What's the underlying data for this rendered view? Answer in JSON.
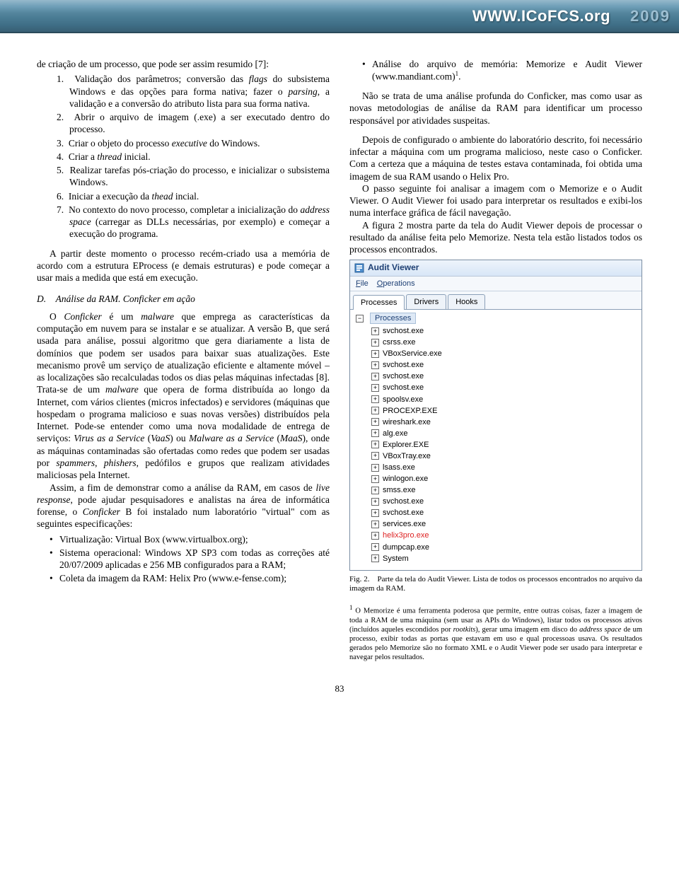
{
  "banner": {
    "url": "WWW.ICoFCS.org",
    "year": "2009"
  },
  "left": {
    "intro": "de criação de um processo, que pode ser assim resumido [7]:",
    "steps": [
      {
        "n": "1.",
        "t": "Validação dos parâmetros; conversão das <i>flags</i> do subsistema Windows e das opções para forma nativa; fazer o <i>parsing</i>, a validação e a conversão do atributo lista para sua forma nativa."
      },
      {
        "n": "2.",
        "t": "Abrir o arquivo de imagem (.exe) a ser executado dentro do processo."
      },
      {
        "n": "3.",
        "t": "Criar o objeto do processo <i>executive</i> do Windows."
      },
      {
        "n": "4.",
        "t": "Criar a <i>thread</i> inicial."
      },
      {
        "n": "5.",
        "t": "Realizar tarefas pós-criação do processo, e inicializar o subsistema Windows."
      },
      {
        "n": "6.",
        "t": "Iniciar a execução da <i>thead</i> incial."
      },
      {
        "n": "7.",
        "t": "No contexto do novo processo, completar a inicialização do <i>address space</i> (carregar as DLLs necessárias, por exemplo) e começar a execução do programa."
      }
    ],
    "p_after_steps": "A partir deste momento o processo recém-criado usa a memória de acordo com a estrutura EProcess (e demais estruturas) e pode começar a usar mais a medida que está em execução.",
    "section_d": "D. Análise da RAM. Conficker em ação",
    "p_d1": "O <i>Conficker</i> é um <i>malware</i> que emprega as características da computação em nuvem para se instalar e se atualizar. A versão B, que será usada para análise, possui algoritmo que gera diariamente a lista de domínios que podem ser usados para baixar suas atualizações. Este mecanismo provê um serviço de atualização eficiente e altamente móvel – as localizações são recalculadas todos os dias pelas máquinas infectadas [8]. Trata-se de um <i>malware</i> que opera de forma distribuída ao longo da Internet, com vários clientes (micros infectados) e servidores (máquinas que hospedam o programa malicioso e suas novas versões) distribuídos pela Internet. Pode-se entender como uma nova modalidade de entrega de serviços: <i>Virus as a Service</i> (<i>VaaS</i>) ou <i>Malware as a Service</i> (<i>MaaS</i>), onde as máquinas contaminadas são ofertadas como redes que podem ser usadas por <i>spammers</i>, <i>phishers</i>, pedófilos e grupos que realizam atividades maliciosas pela Internet.",
    "p_d2": "Assim, a fim de demonstrar como a análise da RAM, em casos de <i>live response</i>, pode ajudar pesquisadores e analistas na área de informática forense, o <i>Conficker</i> B foi instalado num laboratório \"virtual\" com as seguintes especificações:",
    "specs": [
      "Virtualização: Virtual Box (www.virtualbox.org);",
      "Sistema operacional: Windows XP SP3 com todas as correções até 20/07/2009 aplicadas e 256 MB configurados para a RAM;",
      "Coleta da imagem da RAM: Helix Pro (www.e-fense.com);"
    ]
  },
  "right": {
    "analysis_bullet": "Análise do arquivo de memória: Memorize e Audit Viewer (www.mandiant.com)",
    "p1": "Não se trata de uma análise profunda do Conficker, mas como usar as novas metodologias de análise da RAM para identificar um processo responsável por atividades suspeitas.",
    "p2": "Depois de configurado o ambiente do laboratório descrito, foi necessário infectar a máquina com um programa malicioso, neste caso o Conficker. Com a certeza que a máquina de testes estava contaminada, foi obtida uma imagem de sua RAM usando o Helix Pro.",
    "p3": "O passo seguinte foi analisar a imagem com o Memorize e o Audit Viewer. O Audit Viewer foi usado para interpretar os resultados e exibi-los numa interface gráfica de fácil navegação.",
    "p4": "A figura 2 mostra parte da tela do Audit Viewer depois de processar o resultado da análise feita pelo Memorize. Nesta tela estão listados todos os processos encontrados.",
    "fig_caption": "Fig. 2. Parte da tela do Audit Viewer. Lista de todos os processos encontrados no arquivo da imagem da RAM.",
    "footnote": "O Memorize é uma ferramenta poderosa que permite, entre outras coisas, fazer a imagem de toda a RAM de uma máquina (sem usar as APIs do Windows), listar todos os processos ativos (incluídos aqueles escondidos por <i>rootkits</i>), gerar uma imagem em disco do <i>address space</i> de um processo, exibir todas as portas que estavam em uso e qual processoas usava. Os resultados gerados pelo Memorize são no formato XML e o Audit Viewer pode ser usado para interpretar e navegar pelos resultados."
  },
  "audit": {
    "title": "Audit Viewer",
    "menu_file": "File",
    "menu_ops": "Operations",
    "tabs": [
      "Processes",
      "Drivers",
      "Hooks"
    ],
    "root": "Processes",
    "items": [
      {
        "label": "svchost.exe",
        "red": false
      },
      {
        "label": "csrss.exe",
        "red": false
      },
      {
        "label": "VBoxService.exe",
        "red": false
      },
      {
        "label": "svchost.exe",
        "red": false
      },
      {
        "label": "svchost.exe",
        "red": false
      },
      {
        "label": "svchost.exe",
        "red": false
      },
      {
        "label": "spoolsv.exe",
        "red": false
      },
      {
        "label": "PROCEXP.EXE",
        "red": false
      },
      {
        "label": "wireshark.exe",
        "red": false
      },
      {
        "label": "alg.exe",
        "red": false
      },
      {
        "label": "Explorer.EXE",
        "red": false
      },
      {
        "label": "VBoxTray.exe",
        "red": false
      },
      {
        "label": "lsass.exe",
        "red": false
      },
      {
        "label": "winlogon.exe",
        "red": false
      },
      {
        "label": "smss.exe",
        "red": false
      },
      {
        "label": "svchost.exe",
        "red": false
      },
      {
        "label": "svchost.exe",
        "red": false
      },
      {
        "label": "services.exe",
        "red": false
      },
      {
        "label": "helix3pro.exe",
        "red": true
      },
      {
        "label": "dumpcap.exe",
        "red": false
      },
      {
        "label": "System",
        "red": false
      }
    ]
  },
  "page_number": "83"
}
